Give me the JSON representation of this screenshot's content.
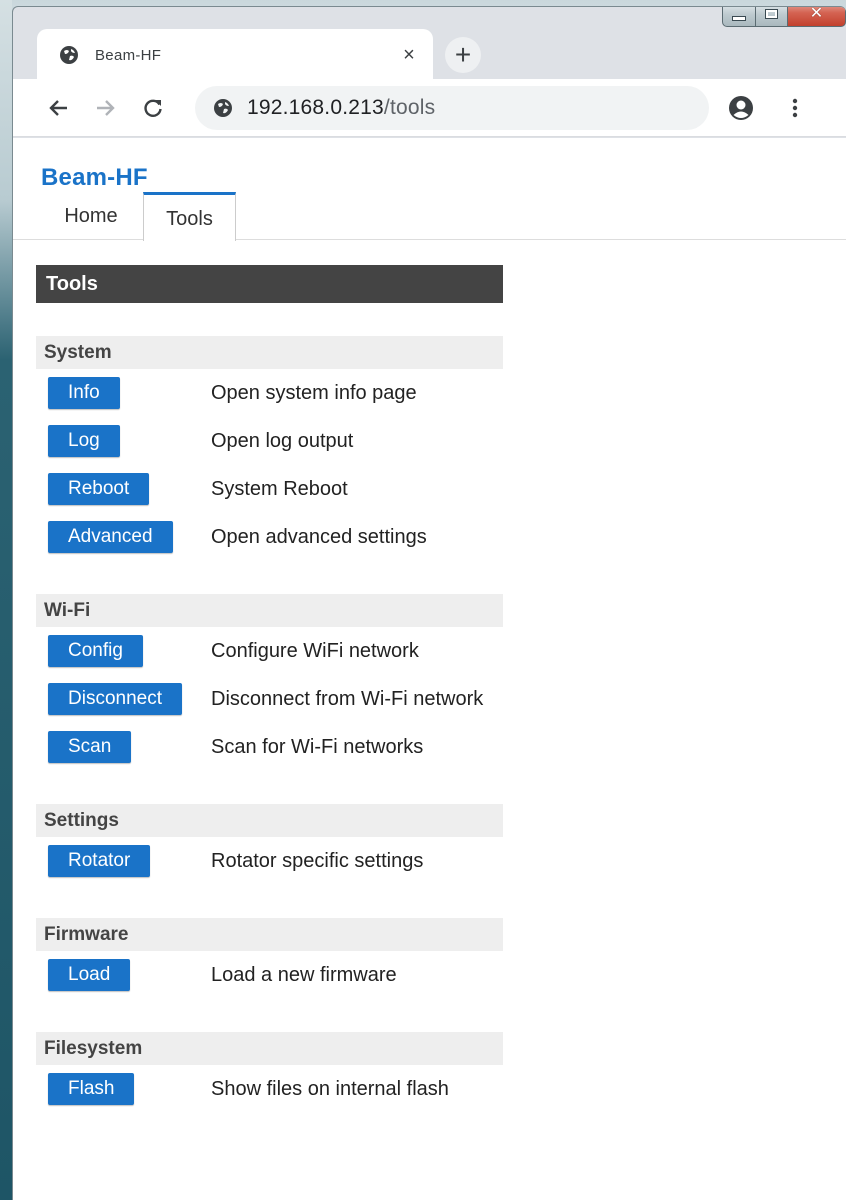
{
  "browser": {
    "tab_title": "Beam-HF",
    "tab_close": "×",
    "new_tab": "+",
    "url_host": "192.168.0.213",
    "url_path": "/tools"
  },
  "site": {
    "title": "Beam-HF",
    "nav": [
      {
        "label": "Home"
      },
      {
        "label": "Tools"
      }
    ],
    "active_tab": "Tools"
  },
  "panel": {
    "title": "Tools",
    "sections": [
      {
        "title": "System",
        "rows": [
          {
            "button": "Info",
            "description": "Open system info page"
          },
          {
            "button": "Log",
            "description": "Open log output"
          },
          {
            "button": "Reboot",
            "description": "System Reboot"
          },
          {
            "button": "Advanced",
            "description": "Open advanced settings"
          }
        ]
      },
      {
        "title": "Wi-Fi",
        "rows": [
          {
            "button": "Config",
            "description": "Configure WiFi network"
          },
          {
            "button": "Disconnect",
            "description": "Disconnect from Wi-Fi network"
          },
          {
            "button": "Scan",
            "description": "Scan for Wi-Fi networks"
          }
        ]
      },
      {
        "title": "Settings",
        "rows": [
          {
            "button": "Rotator",
            "description": "Rotator specific settings"
          }
        ]
      },
      {
        "title": "Firmware",
        "rows": [
          {
            "button": "Load",
            "description": "Load a new firmware"
          }
        ]
      },
      {
        "title": "Filesystem",
        "rows": [
          {
            "button": "Flash",
            "description": "Show files on internal flash"
          }
        ]
      }
    ]
  },
  "colors": {
    "accent": "#1a73c8",
    "panel_header_bg": "#444444",
    "section_header_bg": "#eeeeee"
  },
  "icons": {
    "favicon": "globe-icon",
    "back": "arrow-left-icon",
    "forward": "arrow-right-icon",
    "reload": "reload-icon",
    "site_info": "globe-icon",
    "profile": "account-circle-icon",
    "menu": "kebab-menu-icon"
  }
}
